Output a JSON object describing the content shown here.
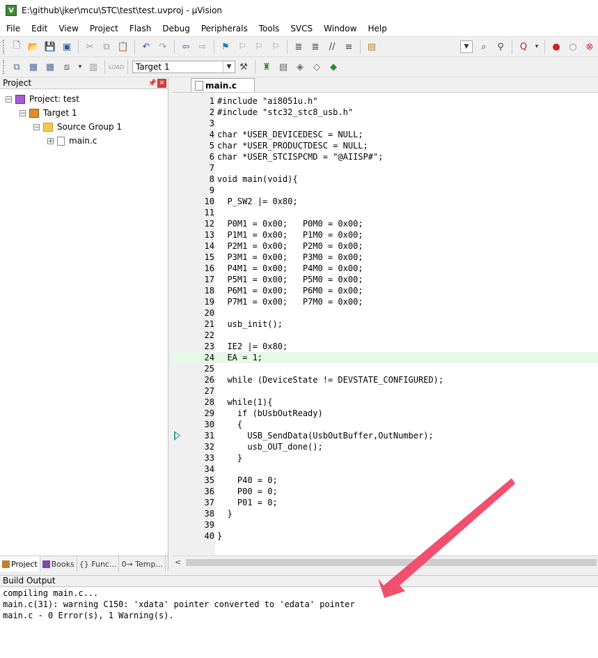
{
  "window": {
    "title": "E:\\github\\jker\\mcu\\STC\\test\\test.uvproj - µVision"
  },
  "menu": [
    "File",
    "Edit",
    "View",
    "Project",
    "Flash",
    "Debug",
    "Peripherals",
    "Tools",
    "SVCS",
    "Window",
    "Help"
  ],
  "toolbar2": {
    "target_value": "Target 1"
  },
  "project_panel": {
    "title": "Project",
    "tree": {
      "project": "Project: test",
      "target": "Target 1",
      "group": "Source Group 1",
      "file": "main.c"
    },
    "tabs": [
      "Project",
      "Books",
      "{} Func...",
      "0→ Temp..."
    ]
  },
  "editor": {
    "tab": "main.c",
    "current_line": 24,
    "exec_arrow_line": 31,
    "lines": [
      {
        "n": "1",
        "t": "#include \"ai8051u.h\""
      },
      {
        "n": "2",
        "t": "#include \"stc32_stc8_usb.h\""
      },
      {
        "n": "3",
        "t": ""
      },
      {
        "n": "4",
        "t": "char *USER_DEVICEDESC = NULL;"
      },
      {
        "n": "5",
        "t": "char *USER_PRODUCTDESC = NULL;"
      },
      {
        "n": "6",
        "t": "char *USER_STCISPCMD = \"@AIISP#\";"
      },
      {
        "n": "7",
        "t": ""
      },
      {
        "n": "8",
        "t": "void main(void){"
      },
      {
        "n": "9",
        "t": ""
      },
      {
        "n": "10",
        "t": "  P_SW2 |= 0x80;"
      },
      {
        "n": "11",
        "t": ""
      },
      {
        "n": "12",
        "t": "  P0M1 = 0x00;   P0M0 = 0x00;"
      },
      {
        "n": "13",
        "t": "  P1M1 = 0x00;   P1M0 = 0x00;"
      },
      {
        "n": "14",
        "t": "  P2M1 = 0x00;   P2M0 = 0x00;"
      },
      {
        "n": "15",
        "t": "  P3M1 = 0x00;   P3M0 = 0x00;"
      },
      {
        "n": "16",
        "t": "  P4M1 = 0x00;   P4M0 = 0x00;"
      },
      {
        "n": "17",
        "t": "  P5M1 = 0x00;   P5M0 = 0x00;"
      },
      {
        "n": "18",
        "t": "  P6M1 = 0x00;   P6M0 = 0x00;"
      },
      {
        "n": "19",
        "t": "  P7M1 = 0x00;   P7M0 = 0x00;"
      },
      {
        "n": "20",
        "t": ""
      },
      {
        "n": "21",
        "t": "  usb_init();"
      },
      {
        "n": "22",
        "t": ""
      },
      {
        "n": "23",
        "t": "  IE2 |= 0x80;"
      },
      {
        "n": "24",
        "t": "  EA = 1;"
      },
      {
        "n": "25",
        "t": ""
      },
      {
        "n": "26",
        "t": "  while (DeviceState != DEVSTATE_CONFIGURED);"
      },
      {
        "n": "27",
        "t": ""
      },
      {
        "n": "28",
        "t": "  while(1){"
      },
      {
        "n": "29",
        "t": "    if (bUsbOutReady)"
      },
      {
        "n": "30",
        "t": "    {"
      },
      {
        "n": "31",
        "t": "      USB_SendData(UsbOutBuffer,OutNumber);"
      },
      {
        "n": "32",
        "t": "      usb_OUT_done();"
      },
      {
        "n": "33",
        "t": "    }"
      },
      {
        "n": "34",
        "t": ""
      },
      {
        "n": "35",
        "t": "    P40 = 0;"
      },
      {
        "n": "36",
        "t": "    P00 = 0;"
      },
      {
        "n": "37",
        "t": "    P01 = 0;"
      },
      {
        "n": "38",
        "t": "  }"
      },
      {
        "n": "39",
        "t": ""
      },
      {
        "n": "40",
        "t": "}"
      }
    ]
  },
  "build_output": {
    "title": "Build Output",
    "lines": [
      "compiling main.c...",
      "main.c(31): warning C150: 'xdata' pointer converted to 'edata' pointer",
      "main.c - 0 Error(s), 1 Warning(s)."
    ]
  },
  "colors": {
    "current_line_bg": "#e8f8e8",
    "annotation_arrow": "#f0506e"
  }
}
